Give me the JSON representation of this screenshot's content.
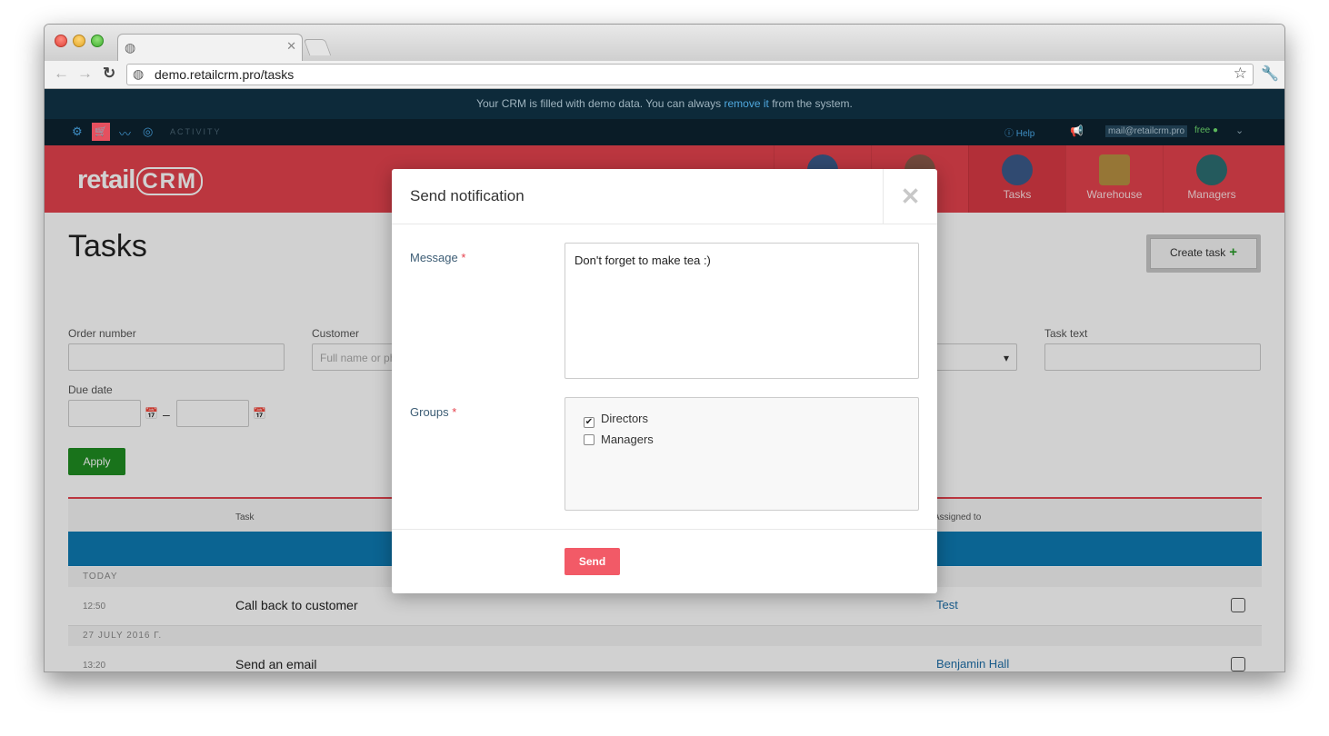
{
  "browser": {
    "url": "demo.retailcrm.pro/tasks"
  },
  "banner": {
    "text_before": "Your CRM is filled with demo data. You can always",
    "link": "remove it",
    "text_after": "from the system."
  },
  "utility": {
    "activity_label": "ACTIVITY",
    "help_label": "Help",
    "email": "mail@retailcrm.pro",
    "plan": "free"
  },
  "header": {
    "logo": "retail",
    "logo_crm": "CRM",
    "nav": [
      {
        "label": "Tasks",
        "avatar_color": "#3b5b8a"
      },
      {
        "label": "Warehouse",
        "avatar_color": "#b89042"
      },
      {
        "label": "Managers",
        "avatar_color": "#2d6e72"
      }
    ]
  },
  "page": {
    "title": "Tasks",
    "create_button": "Create task"
  },
  "filters": {
    "order_number_label": "Order number",
    "customer_label": "Customer",
    "customer_placeholder": "Full name or phone",
    "task_text_label": "Task text",
    "due_date_label": "Due date",
    "apply_button": "Apply"
  },
  "table": {
    "columns": {
      "task": "Task",
      "assigned_to": "Assigned to"
    },
    "groups": [
      {
        "label": "TODAY",
        "rows": [
          {
            "time": "12:50",
            "task": "Call back to customer",
            "assignee": "Test"
          }
        ]
      },
      {
        "label": "27 JULY 2016 Г.",
        "rows": [
          {
            "time": "13:20",
            "task": "Send an email",
            "assignee": "Benjamin Hall"
          }
        ]
      }
    ]
  },
  "modal": {
    "title": "Send notification",
    "message_label": "Message",
    "message_value": "Don't forget to make tea :)",
    "groups_label": "Groups",
    "group_options": [
      {
        "label": "Directors",
        "checked": true
      },
      {
        "label": "Managers",
        "checked": false
      }
    ],
    "send_button": "Send"
  }
}
